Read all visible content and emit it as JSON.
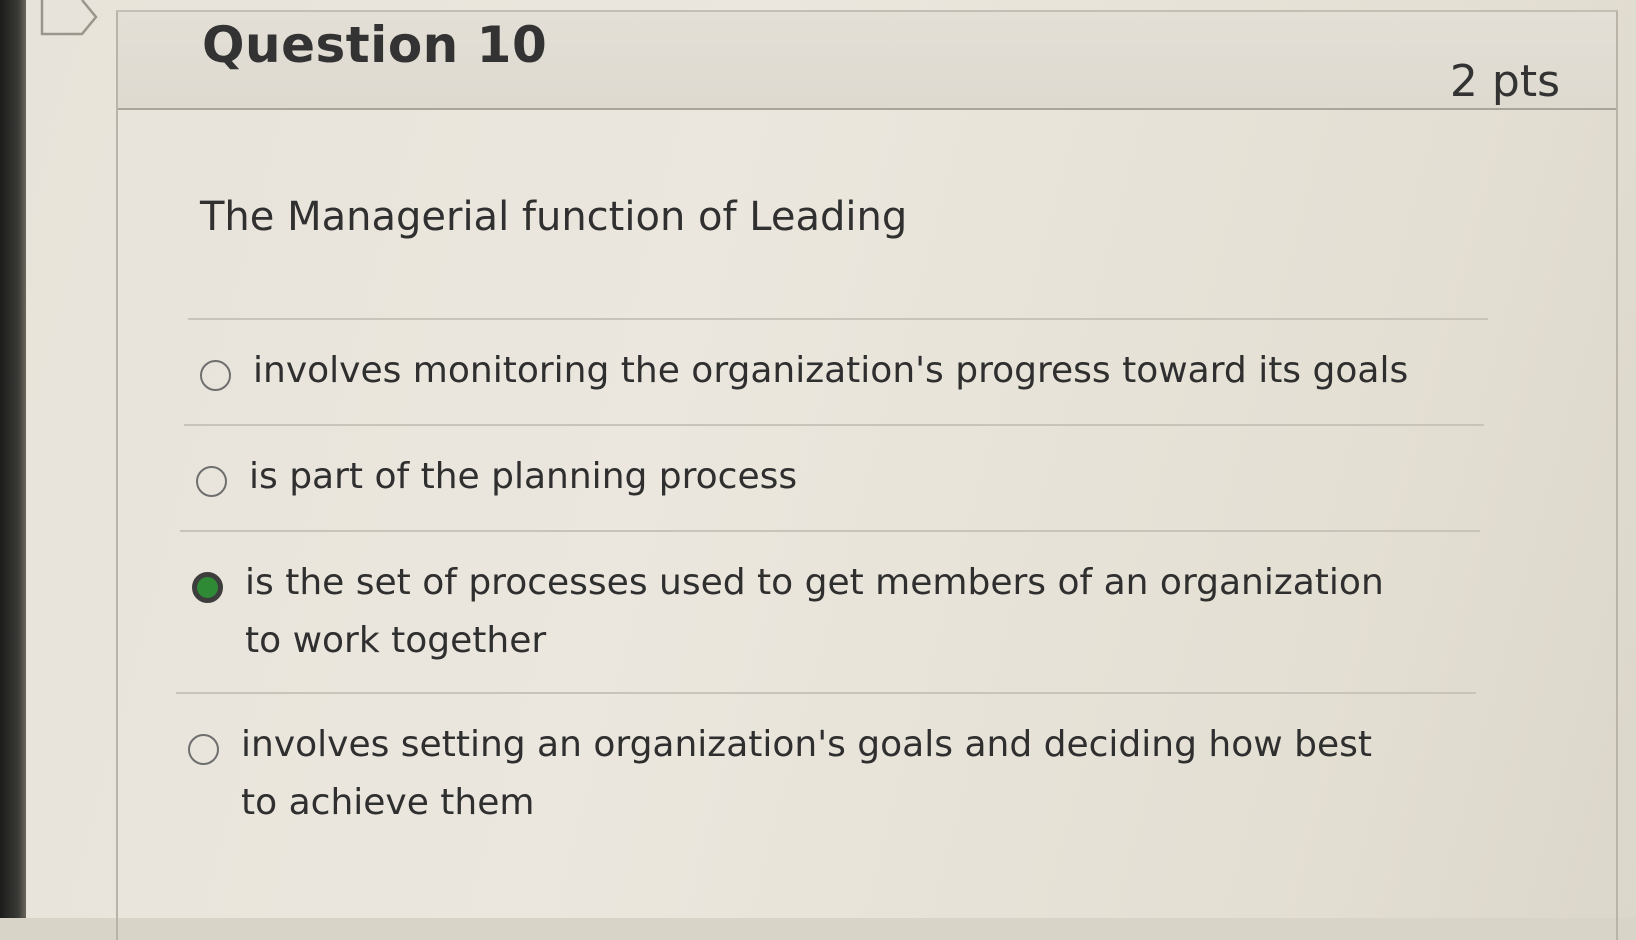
{
  "question": {
    "title": "Question 10",
    "points": "2 pts",
    "prompt": "The Managerial function of Leading"
  },
  "answers": [
    {
      "label": "involves monitoring the organization's progress toward its goals",
      "selected": false
    },
    {
      "label": "is part of the planning process",
      "selected": false
    },
    {
      "label": "is the set of processes used to get members of an organization to work together",
      "selected": true
    },
    {
      "label": "involves setting an organization's goals and deciding how best to achieve them",
      "selected": false
    }
  ],
  "colors": {
    "selected_radio": "#2f8a36",
    "text": "#2f2f2f"
  }
}
